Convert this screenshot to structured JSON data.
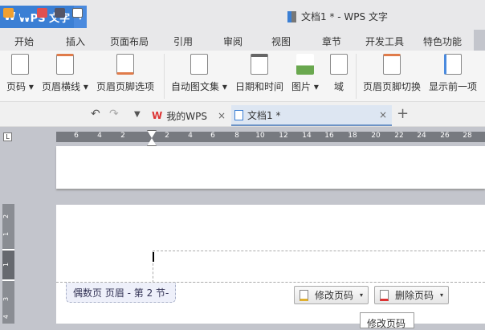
{
  "app": {
    "name": "WPS 文字",
    "window_title": "文档1 * - WPS 文字"
  },
  "menu_tabs": [
    "开始",
    "插入",
    "页面布局",
    "引用",
    "审阅",
    "视图",
    "章节",
    "开发工具",
    "特色功能"
  ],
  "ribbon": {
    "page_number": "页码",
    "header_line": "页眉横线",
    "header_footer_options": "页眉页脚选项",
    "auto_text": "自动图文集",
    "date_time": "日期和时间",
    "picture": "图片",
    "field": "域",
    "switch_header_footer": "页眉页脚切换",
    "show_previous": "显示前一项"
  },
  "doc_tabs": {
    "my_wps": "我的WPS",
    "doc1": "文档1 *"
  },
  "ruler": {
    "ticks": [
      "6",
      "4",
      "2",
      "2",
      "4",
      "6",
      "8",
      "10",
      "12",
      "14",
      "16",
      "18",
      "20",
      "22",
      "24",
      "26",
      "28"
    ],
    "vertical": [
      "2",
      "1",
      "1",
      "3",
      "4"
    ]
  },
  "header": {
    "label": "偶数页 页眉 - 第 2 节-",
    "modify_page_number": "修改页码",
    "delete_page_number": "删除页码",
    "tooltip": "修改页码"
  }
}
